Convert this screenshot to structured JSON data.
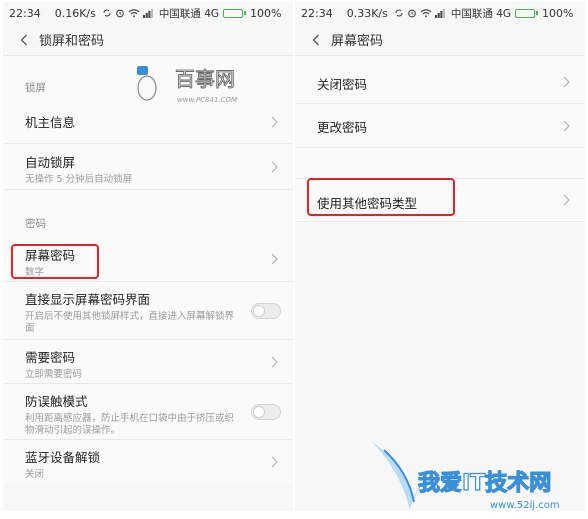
{
  "left": {
    "status": {
      "time": "22:34",
      "speed": "0.16K/s",
      "carrier": "中国联通 4G",
      "battery": "100%"
    },
    "title": "锁屏和密码",
    "sections": [
      {
        "header": "锁屏"
      },
      {
        "header": "密码"
      }
    ],
    "items": {
      "owner_info": {
        "label": "机主信息"
      },
      "auto_lock": {
        "label": "自动锁屏",
        "sub": "无操作 5 分钟后自动锁屏"
      },
      "screen_password": {
        "label": "屏幕密码",
        "sub": "数字"
      },
      "show_password_screen": {
        "label": "直接显示屏幕密码界面",
        "sub": "开启后不使用其他锁屏样式，直接进入屏幕解锁界面"
      },
      "require_password": {
        "label": "需要密码",
        "sub": "立即需要密码"
      },
      "anti_mistouch": {
        "label": "防误触模式",
        "sub": "利用距离感应器，防止手机在口袋中由于挤压或织物滑动引起的误操作。"
      },
      "bluetooth_unlock": {
        "label": "蓝牙设备解锁",
        "sub": "关闭"
      }
    }
  },
  "right": {
    "status": {
      "time": "22:34",
      "speed": "0.33K/s",
      "carrier": "中国联通 4G",
      "battery": "100%"
    },
    "title": "屏幕密码",
    "items": {
      "turn_off": {
        "label": "关闭密码"
      },
      "change": {
        "label": "更改密码"
      },
      "other_type": {
        "label": "使用其他密码类型"
      }
    }
  },
  "watermarks": {
    "top": {
      "text": "百事网",
      "url": "www.PC841.COM"
    },
    "bottom": {
      "text": "我爱IT技术网",
      "url": "www.52ij.com"
    }
  },
  "colors": {
    "highlight": "#e0252a",
    "battery": "#4caf50",
    "watermark_blue": "#3a8fd8"
  }
}
